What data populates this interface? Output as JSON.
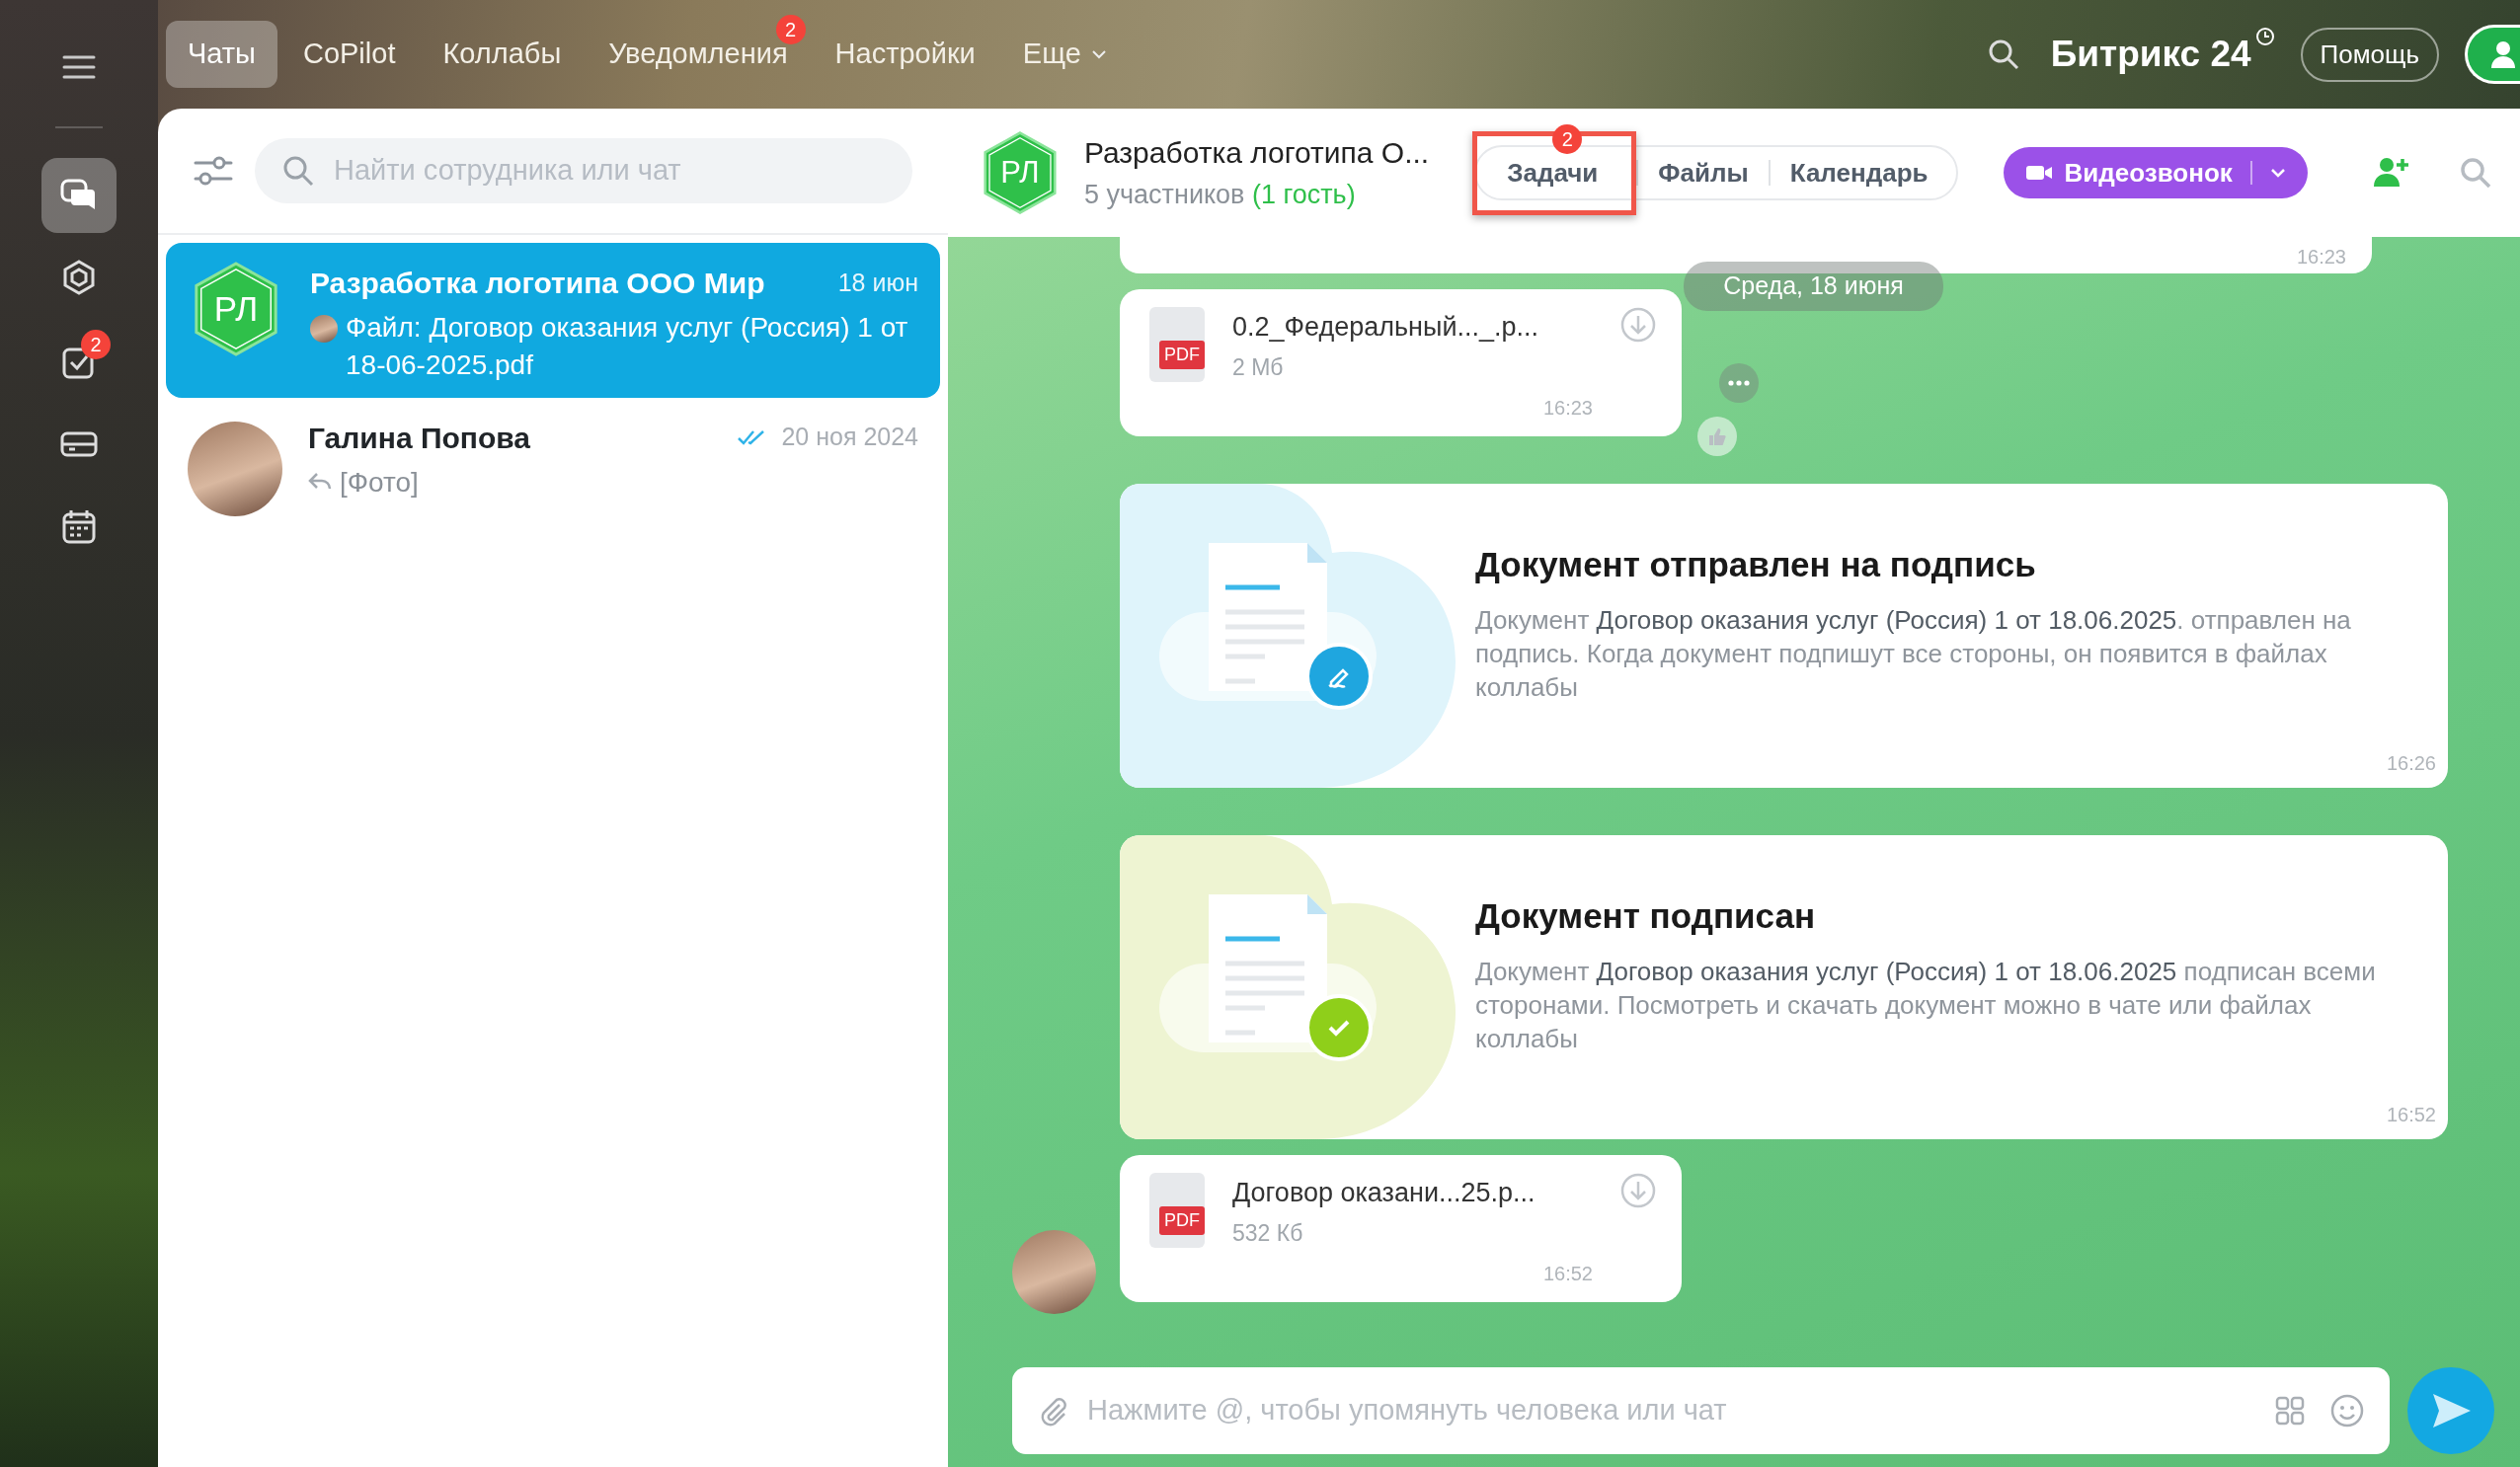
{
  "top_nav": {
    "items": [
      {
        "label": "Чаты",
        "selected": true
      },
      {
        "label": "CoPilot",
        "selected": false
      },
      {
        "label": "Коллабы",
        "selected": false
      },
      {
        "label": "Уведомления",
        "selected": false,
        "badge": "2"
      },
      {
        "label": "Настройки",
        "selected": false
      },
      {
        "label": "Еще",
        "selected": false,
        "dropdown": true
      }
    ],
    "brand": "Битрикс 24",
    "help": "Помощь"
  },
  "rail": {
    "items": [
      {
        "kind": "chats",
        "selected": true
      },
      {
        "kind": "collab",
        "selected": false
      },
      {
        "kind": "tasks",
        "selected": false,
        "badge": "2"
      },
      {
        "kind": "drive",
        "selected": false
      },
      {
        "kind": "calendar",
        "selected": false
      }
    ]
  },
  "chat_list": {
    "search": {
      "placeholder": "Найти сотрудника или чат"
    },
    "chats": [
      {
        "title": "Разработка логотипа ООО Мир",
        "time": "18 июн",
        "avatar": {
          "kind": "initials",
          "text": "РЛ"
        },
        "preview": "Файл: Договор оказания услуг (Россия) 1 от 18-06-2025.pdf",
        "kind": "author",
        "selected": true,
        "read": false
      },
      {
        "title": "Галина Попова",
        "time": "20 ноя 2024",
        "avatar": {
          "kind": "photo"
        },
        "preview": "[Фото]",
        "kind": "reply",
        "selected": false,
        "read": true
      }
    ]
  },
  "header": {
    "avatar": "РЛ",
    "title": "Разработка логотипа О...",
    "members": "5 участников",
    "guests": "(1 гость)",
    "tabs": [
      {
        "label": "Задачи",
        "badge": "2",
        "highlighted": true
      },
      {
        "label": "Файлы",
        "highlighted": false
      },
      {
        "label": "Календарь",
        "highlighted": false
      }
    ],
    "call_button": "Видеозвонок"
  },
  "messages": [
    {
      "kind": "cut",
      "time": "16:23"
    },
    {
      "kind": "date",
      "text": "Среда, 18 июня"
    },
    {
      "kind": "file",
      "type_label": "PDF",
      "name": "0.2_Федеральный..._.р...",
      "size": "2 Мб",
      "time": "16:23",
      "author_photo": false,
      "actions": true
    },
    {
      "kind": "doc_sent",
      "title": "Документ отправлен на подпись",
      "text": "Документ **Договор оказания услуг (Россия) 1 от 18.06.2025**. отправлен на подпись. Когда документ подпишут все стороны, он появится в файлах коллабы",
      "time": "16:26"
    },
    {
      "kind": "doc_signed",
      "title": "Документ подписан",
      "text": "Документ **Договор оказания услуг (Россия) 1 от 18.06.2025** подписан всеми сторонами. Посмотреть и скачать документ можно в чате или файлах коллабы",
      "time": "16:52"
    },
    {
      "kind": "file",
      "type_label": "PDF",
      "name": "Договор оказани...25.р...",
      "size": "532 Кб",
      "time": "16:52",
      "author_photo": true,
      "actions": false
    }
  ],
  "composer": {
    "placeholder": "Нажмите @, чтобы упомянуть человека или чат"
  }
}
